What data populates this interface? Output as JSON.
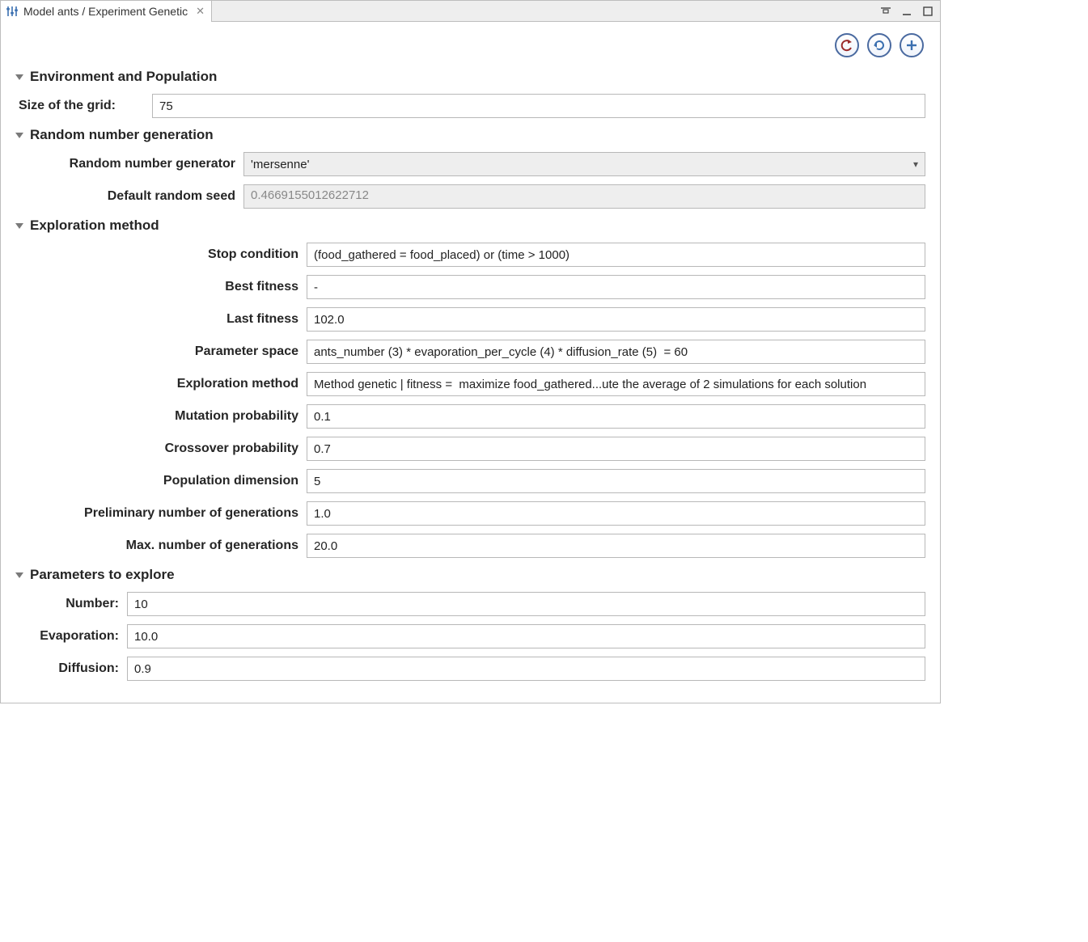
{
  "tab": {
    "title": "Model ants / Experiment Genetic"
  },
  "sections": {
    "env": {
      "title": "Environment and Population",
      "size_label": "Size of the grid:",
      "size_value": "75"
    },
    "rng": {
      "title": "Random number generation",
      "generator_label": "Random number generator",
      "generator_value": "'mersenne'",
      "seed_label": "Default random seed",
      "seed_value": "0.4669155012622712"
    },
    "exploration": {
      "title": "Exploration method",
      "stop_label": "Stop condition",
      "stop_value": "(food_gathered = food_placed) or (time > 1000)",
      "best_label": "Best fitness",
      "best_value": "-",
      "last_label": "Last fitness",
      "last_value": "102.0",
      "space_label": "Parameter space",
      "space_value": "ants_number (3) * evaporation_per_cycle (4) * diffusion_rate (5)  = 60",
      "method_label": "Exploration method",
      "method_value": "Method genetic | fitness =  maximize food_gathered...ute the average of 2 simulations for each solution",
      "mutation_label": "Mutation probability",
      "mutation_value": "0.1",
      "crossover_label": "Crossover probability",
      "crossover_value": "0.7",
      "popdim_label": "Population dimension",
      "popdim_value": "5",
      "prelim_label": "Preliminary number of generations",
      "prelim_value": "1.0",
      "maxgen_label": "Max. number of generations",
      "maxgen_value": "20.0"
    },
    "params": {
      "title": "Parameters to explore",
      "number_label": "Number:",
      "number_value": "10",
      "evap_label": "Evaporation:",
      "evap_value": "10.0",
      "diff_label": "Diffusion:",
      "diff_value": "0.9"
    }
  }
}
